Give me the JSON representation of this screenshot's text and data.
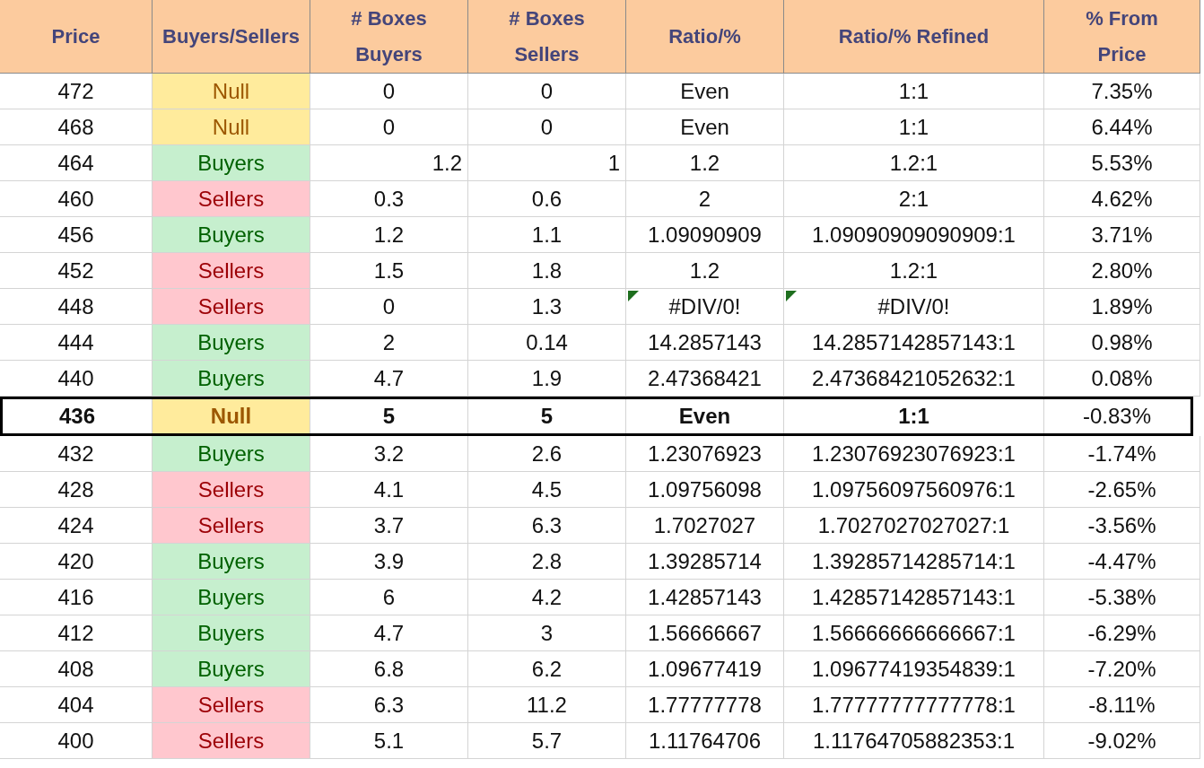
{
  "table": {
    "columns": [
      "Price",
      "Buyers/Sellers",
      "# Boxes Buyers",
      "# Boxes Sellers",
      "Ratio/%",
      "Ratio/% Refined",
      "% From Price"
    ],
    "rows": [
      {
        "price": "472",
        "kind": "null",
        "side": "Null",
        "boxes_buyers": "0",
        "boxes_sellers": "0",
        "ratio": "Even",
        "refined": "1:1",
        "pct": "7.35%",
        "flagged": false,
        "current": false,
        "right_aligned": false
      },
      {
        "price": "468",
        "kind": "null",
        "side": "Null",
        "boxes_buyers": "0",
        "boxes_sellers": "0",
        "ratio": "Even",
        "refined": "1:1",
        "pct": "6.44%",
        "flagged": false,
        "current": false,
        "right_aligned": false
      },
      {
        "price": "464",
        "kind": "buyers",
        "side": "Buyers",
        "boxes_buyers": "1.2",
        "boxes_sellers": "1",
        "ratio": "1.2",
        "refined": "1.2:1",
        "pct": "5.53%",
        "flagged": false,
        "current": false,
        "right_aligned": true
      },
      {
        "price": "460",
        "kind": "sellers",
        "side": "Sellers",
        "boxes_buyers": "0.3",
        "boxes_sellers": "0.6",
        "ratio": "2",
        "refined": "2:1",
        "pct": "4.62%",
        "flagged": false,
        "current": false,
        "right_aligned": false
      },
      {
        "price": "456",
        "kind": "buyers",
        "side": "Buyers",
        "boxes_buyers": "1.2",
        "boxes_sellers": "1.1",
        "ratio": "1.09090909",
        "refined": "1.09090909090909:1",
        "pct": "3.71%",
        "flagged": false,
        "current": false,
        "right_aligned": false
      },
      {
        "price": "452",
        "kind": "sellers",
        "side": "Sellers",
        "boxes_buyers": "1.5",
        "boxes_sellers": "1.8",
        "ratio": "1.2",
        "refined": "1.2:1",
        "pct": "2.80%",
        "flagged": false,
        "current": false,
        "right_aligned": false
      },
      {
        "price": "448",
        "kind": "sellers",
        "side": "Sellers",
        "boxes_buyers": "0",
        "boxes_sellers": "1.3",
        "ratio": "#DIV/0!",
        "refined": "#DIV/0!",
        "pct": "1.89%",
        "flagged": true,
        "current": false,
        "right_aligned": false
      },
      {
        "price": "444",
        "kind": "buyers",
        "side": "Buyers",
        "boxes_buyers": "2",
        "boxes_sellers": "0.14",
        "ratio": "14.2857143",
        "refined": "14.2857142857143:1",
        "pct": "0.98%",
        "flagged": false,
        "current": false,
        "right_aligned": false
      },
      {
        "price": "440",
        "kind": "buyers",
        "side": "Buyers",
        "boxes_buyers": "4.7",
        "boxes_sellers": "1.9",
        "ratio": "2.47368421",
        "refined": "2.47368421052632:1",
        "pct": "0.08%",
        "flagged": false,
        "current": false,
        "right_aligned": false
      },
      {
        "price": "436",
        "kind": "null",
        "side": "Null",
        "boxes_buyers": "5",
        "boxes_sellers": "5",
        "ratio": "Even",
        "refined": "1:1",
        "pct": "-0.83%",
        "flagged": false,
        "current": true,
        "right_aligned": false
      },
      {
        "price": "432",
        "kind": "buyers",
        "side": "Buyers",
        "boxes_buyers": "3.2",
        "boxes_sellers": "2.6",
        "ratio": "1.23076923",
        "refined": "1.23076923076923:1",
        "pct": "-1.74%",
        "flagged": false,
        "current": false,
        "right_aligned": false
      },
      {
        "price": "428",
        "kind": "sellers",
        "side": "Sellers",
        "boxes_buyers": "4.1",
        "boxes_sellers": "4.5",
        "ratio": "1.09756098",
        "refined": "1.09756097560976:1",
        "pct": "-2.65%",
        "flagged": false,
        "current": false,
        "right_aligned": false
      },
      {
        "price": "424",
        "kind": "sellers",
        "side": "Sellers",
        "boxes_buyers": "3.7",
        "boxes_sellers": "6.3",
        "ratio": "1.7027027",
        "refined": "1.7027027027027:1",
        "pct": "-3.56%",
        "flagged": false,
        "current": false,
        "right_aligned": false
      },
      {
        "price": "420",
        "kind": "buyers",
        "side": "Buyers",
        "boxes_buyers": "3.9",
        "boxes_sellers": "2.8",
        "ratio": "1.39285714",
        "refined": "1.39285714285714:1",
        "pct": "-4.47%",
        "flagged": false,
        "current": false,
        "right_aligned": false
      },
      {
        "price": "416",
        "kind": "buyers",
        "side": "Buyers",
        "boxes_buyers": "6",
        "boxes_sellers": "4.2",
        "ratio": "1.42857143",
        "refined": "1.42857142857143:1",
        "pct": "-5.38%",
        "flagged": false,
        "current": false,
        "right_aligned": false
      },
      {
        "price": "412",
        "kind": "buyers",
        "side": "Buyers",
        "boxes_buyers": "4.7",
        "boxes_sellers": "3",
        "ratio": "1.56666667",
        "refined": "1.56666666666667:1",
        "pct": "-6.29%",
        "flagged": false,
        "current": false,
        "right_aligned": false
      },
      {
        "price": "408",
        "kind": "buyers",
        "side": "Buyers",
        "boxes_buyers": "6.8",
        "boxes_sellers": "6.2",
        "ratio": "1.09677419",
        "refined": "1.09677419354839:1",
        "pct": "-7.20%",
        "flagged": false,
        "current": false,
        "right_aligned": false
      },
      {
        "price": "404",
        "kind": "sellers",
        "side": "Sellers",
        "boxes_buyers": "6.3",
        "boxes_sellers": "11.2",
        "ratio": "1.77777778",
        "refined": "1.77777777777778:1",
        "pct": "-8.11%",
        "flagged": false,
        "current": false,
        "right_aligned": false
      },
      {
        "price": "400",
        "kind": "sellers",
        "side": "Sellers",
        "boxes_buyers": "5.1",
        "boxes_sellers": "5.7",
        "ratio": "1.11764706",
        "refined": "1.11764705882353:1",
        "pct": "-9.02%",
        "flagged": false,
        "current": false,
        "right_aligned": false
      }
    ]
  }
}
